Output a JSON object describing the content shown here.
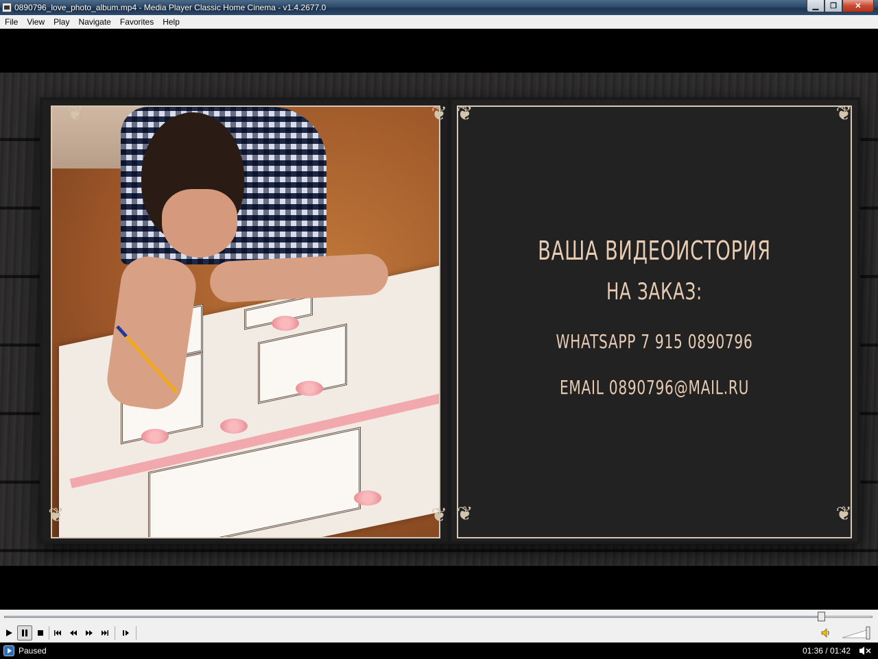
{
  "window": {
    "title": "0890796_love_photo_album.mp4 - Media Player Classic Home Cinema - v1.4.2677.0",
    "minimize": "▁",
    "maximize": "❐",
    "close": "✕"
  },
  "menu": [
    "File",
    "View",
    "Play",
    "Navigate",
    "Favorites",
    "Help"
  ],
  "video": {
    "promo_lines": [
      "ВАША ВИДЕОИСТОРИЯ",
      "НА ЗАКАЗ:",
      "WHATSAPP  7 915 0890796",
      "EMAIL  0890796@MAIL.RU"
    ]
  },
  "player": {
    "progress": 0.941,
    "volume": 1.0,
    "status": "Paused",
    "time": "01:36 / 01:42"
  },
  "toolbar_icons": [
    "play-icon",
    "pause-icon",
    "stop-icon",
    "skip-back-icon",
    "rewind-icon",
    "fast-forward-icon",
    "skip-forward-icon",
    "frame-step-icon"
  ],
  "colors": {
    "titlebar": "#2e4b6b",
    "promo_text": "#e8cbb3",
    "status_bg": "#000000"
  }
}
